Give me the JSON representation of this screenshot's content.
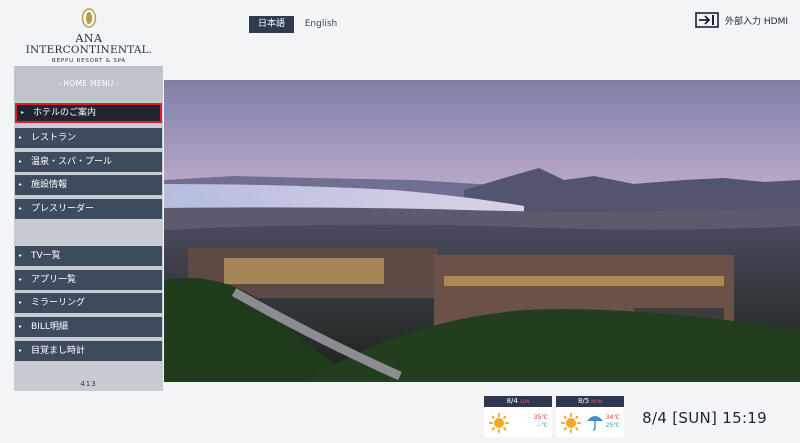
{
  "logo": {
    "line1": "ANA",
    "line2": "INTERCONTINENTAL.",
    "line3": "BEPPU RESORT & SPA"
  },
  "languages": {
    "active": "日本語",
    "inactive": "English"
  },
  "input": {
    "label": "外部入力 HDMI",
    "icon": "input-source-icon"
  },
  "menu": {
    "title": "- HOME MENU -",
    "items": [
      {
        "label": "ホテルのご案内",
        "selected": true
      },
      {
        "label": "レストラン"
      },
      {
        "label": "温泉・スパ・プール"
      },
      {
        "label": "施設情報"
      },
      {
        "label": "プレスリーダー"
      },
      {
        "label": "TV一覧"
      },
      {
        "label": "アプリ一覧"
      },
      {
        "label": "ミラーリング"
      },
      {
        "label": "BILL明細"
      },
      {
        "label": "目覚まし時計"
      }
    ],
    "room": "413"
  },
  "weather": [
    {
      "date": "8/4",
      "dow": "SUN",
      "hi": "35℃",
      "lo": "--℃",
      "icon": "sunny-icon"
    },
    {
      "date": "8/5",
      "dow": "MON",
      "hi": "",
      "lo": "",
      "icon": "sunny-icon"
    },
    {
      "date": "",
      "dow": "",
      "hi": "34℃",
      "lo": "25℃",
      "icon": "sun-with-umbrella-icon"
    }
  ],
  "clock": "8/4 [SUN] 15:19",
  "colors": {
    "menu_item": "#3e4b5f",
    "selected_border": "#d8202a",
    "header_dark": "#2f3a4e"
  }
}
